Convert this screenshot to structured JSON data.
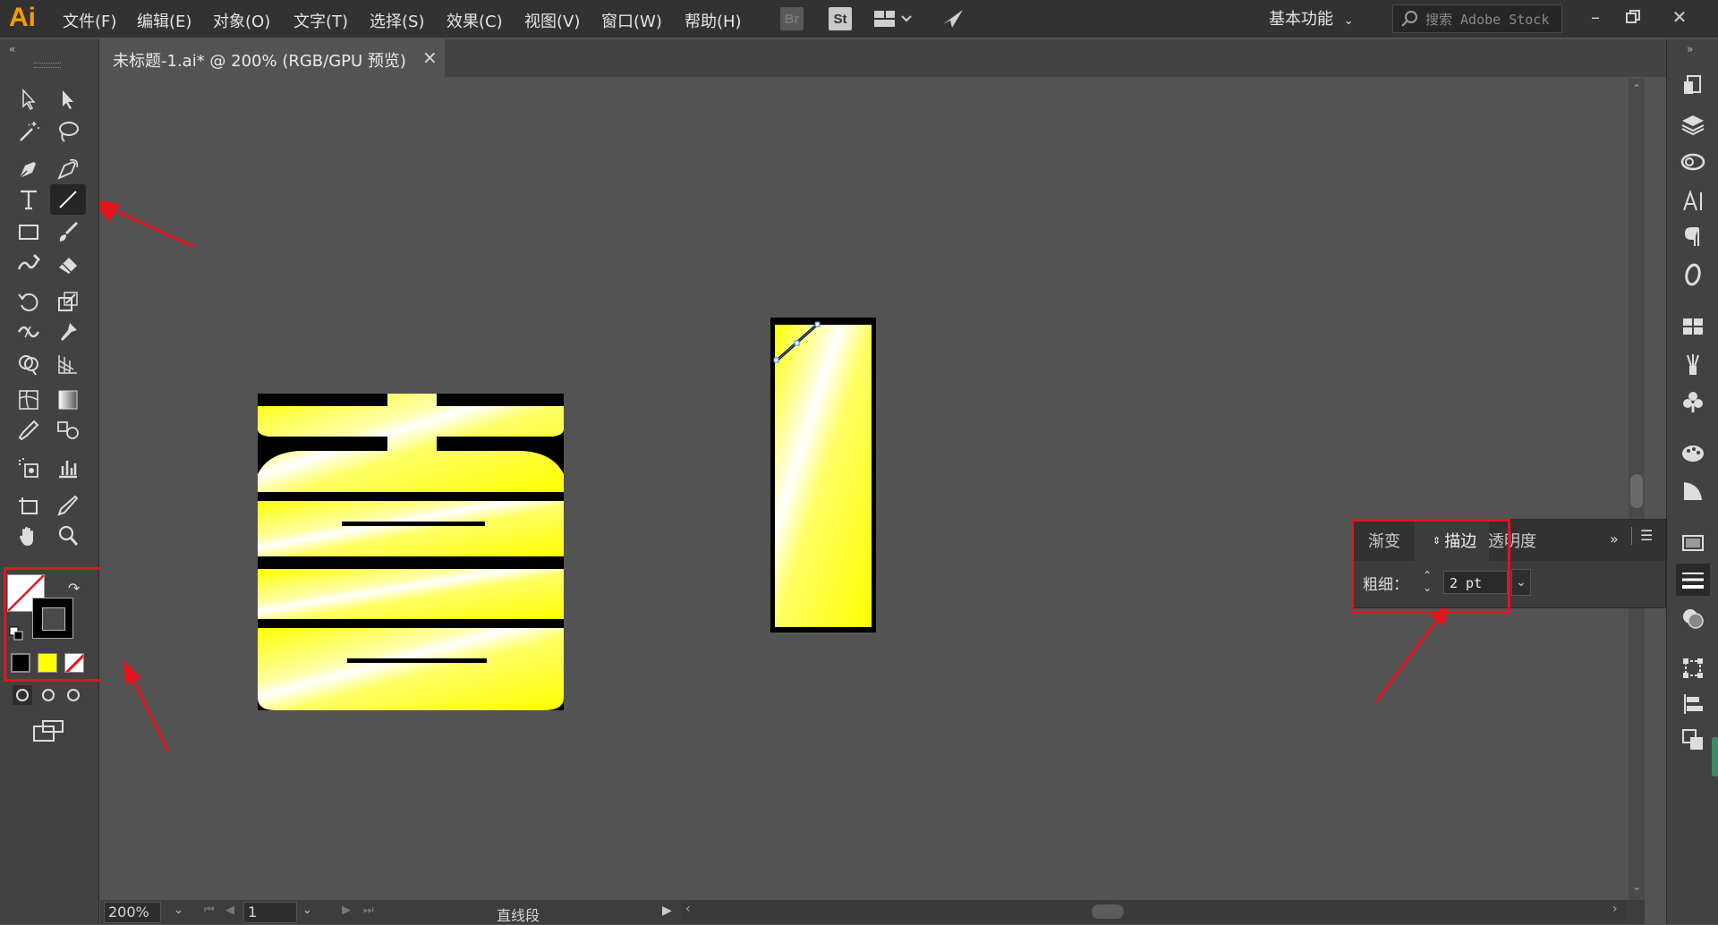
{
  "app": {
    "logo": "Ai"
  },
  "menu": [
    "文件(F)",
    "编辑(E)",
    "对象(O)",
    "文字(T)",
    "选择(S)",
    "效果(C)",
    "视图(V)",
    "窗口(W)",
    "帮助(H)"
  ],
  "menubar_buttons": {
    "bridge": "Br",
    "stock": "St"
  },
  "workspace": {
    "label": "基本功能"
  },
  "search": {
    "placeholder": "搜索 Adobe Stock"
  },
  "document": {
    "tab_title": "未标题-1.ai* @ 200% (RGB/GPU 预览)",
    "close": "×"
  },
  "stroke_panel": {
    "tabs": [
      "渐变",
      "描边",
      "透明度"
    ],
    "active_tab": "描边",
    "weight_label": "粗细：",
    "weight_value": "2 pt"
  },
  "status": {
    "zoom": "200%",
    "artboard": "1",
    "tool_name": "直线段"
  },
  "colors": {
    "accent_red": "#e3141d",
    "fill_yellow": "#ffff00",
    "logo_orange": "#ff9a00"
  },
  "toolbar_icons": [
    "selection-tool-icon",
    "direct-selection-tool-icon",
    "magic-wand-tool-icon",
    "lasso-tool-icon",
    "pen-tool-icon",
    "curvature-tool-icon",
    "type-tool-icon",
    "line-segment-tool-icon",
    "rectangle-tool-icon",
    "paintbrush-tool-icon",
    "shaper-tool-icon",
    "eraser-tool-icon",
    "rotate-tool-icon",
    "scale-tool-icon",
    "width-tool-icon",
    "puppet-warp-tool-icon",
    "shape-builder-tool-icon",
    "perspective-grid-tool-icon",
    "mesh-tool-icon",
    "gradient-tool-icon",
    "eyedropper-tool-icon",
    "blend-tool-icon",
    "symbol-sprayer-tool-icon",
    "column-graph-tool-icon",
    "artboard-tool-icon",
    "slice-tool-icon",
    "hand-tool-icon",
    "zoom-tool-icon"
  ]
}
